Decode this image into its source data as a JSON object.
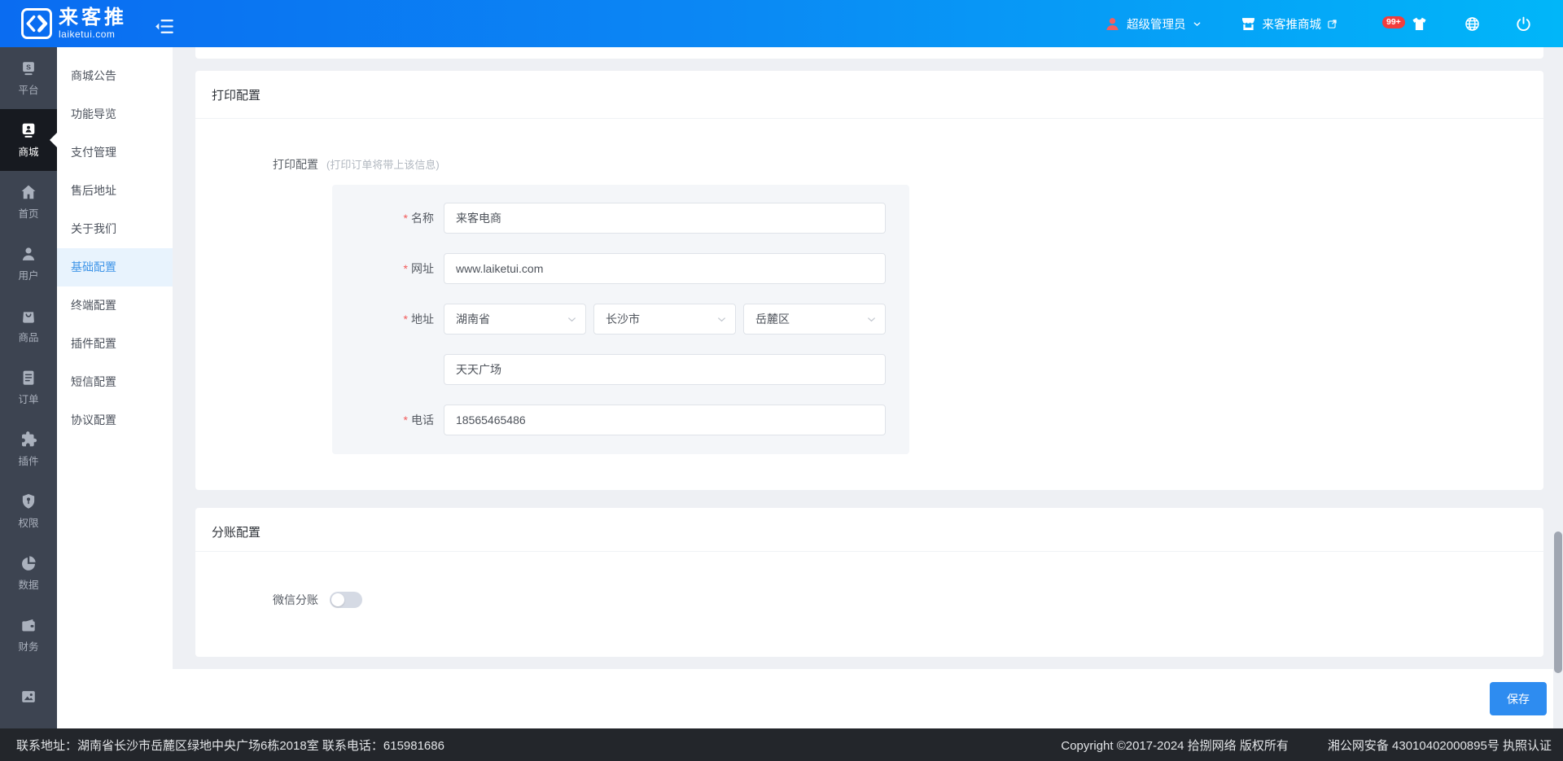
{
  "header": {
    "logo_title": "来客推",
    "logo_subtitle": "laiketui.com",
    "user_name": "超级管理员",
    "shop_name": "来客推商城",
    "notification_badge": "99+"
  },
  "primary_sidebar": {
    "items": [
      {
        "id": "platform",
        "icon": "platform-icon",
        "label": "平台",
        "active": false
      },
      {
        "id": "mall",
        "icon": "mall-icon",
        "label": "商城",
        "active": true
      },
      {
        "id": "home",
        "icon": "home-icon",
        "label": "首页",
        "active": false
      },
      {
        "id": "users",
        "icon": "user-icon",
        "label": "用户",
        "active": false
      },
      {
        "id": "goods",
        "icon": "goods-icon",
        "label": "商品",
        "active": false
      },
      {
        "id": "orders",
        "icon": "order-icon",
        "label": "订单",
        "active": false
      },
      {
        "id": "plugins",
        "icon": "plugin-icon",
        "label": "插件",
        "active": false
      },
      {
        "id": "permissions",
        "icon": "auth-icon",
        "label": "权限",
        "active": false
      },
      {
        "id": "data",
        "icon": "data-icon",
        "label": "数据",
        "active": false
      },
      {
        "id": "finance",
        "icon": "finance-icon",
        "label": "财务",
        "active": false
      },
      {
        "id": "media",
        "icon": "image-icon",
        "label": "",
        "active": false
      }
    ]
  },
  "secondary_sidebar": {
    "items": [
      {
        "label": "商城公告",
        "active": false
      },
      {
        "label": "功能导览",
        "active": false
      },
      {
        "label": "支付管理",
        "active": false
      },
      {
        "label": "售后地址",
        "active": false
      },
      {
        "label": "关于我们",
        "active": false
      },
      {
        "label": "基础配置",
        "active": true
      },
      {
        "label": "终端配置",
        "active": false
      },
      {
        "label": "插件配置",
        "active": false
      },
      {
        "label": "短信配置",
        "active": false
      },
      {
        "label": "协议配置",
        "active": false
      }
    ]
  },
  "print_section": {
    "card_title": "打印配置",
    "group_label": "打印配置",
    "group_hint": "(打印订单将带上该信息)",
    "name_label": "名称",
    "name_value": "来客电商",
    "website_label": "网址",
    "website_value": "www.laiketui.com",
    "address_label": "地址",
    "province": "湖南省",
    "city": "长沙市",
    "district": "岳麓区",
    "address_detail": "天天广场",
    "phone_label": "电话",
    "phone_value": "18565465486"
  },
  "split_section": {
    "card_title": "分账配置",
    "wechat_label": "微信分账",
    "wechat_enabled": false
  },
  "actions": {
    "save_label": "保存"
  },
  "footer": {
    "contact": "联系地址：湖南省长沙市岳麓区绿地中央广场6栋2018室 联系电话：615981686",
    "copyright": "Copyright ©2017-2024 拾捌网络 版权所有",
    "security": "湘公网安备 43010402000895号 执照认证"
  }
}
